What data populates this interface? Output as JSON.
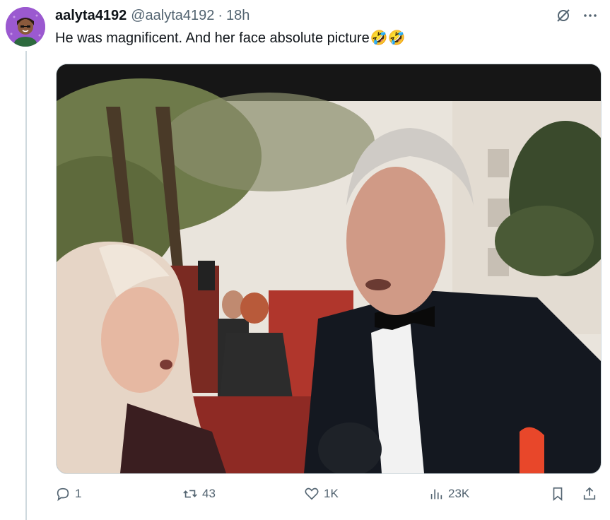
{
  "post": {
    "display_name": "aalyta4192",
    "handle": "@aalyta4192",
    "separator": "·",
    "time": "18h",
    "text": "He was magnificent. And her face absolute picture",
    "emojis": "🤣🤣"
  },
  "actions": {
    "replies": "1",
    "reposts": "43",
    "likes": "1K",
    "views": "23K"
  },
  "icons": [
    "avatar",
    "grok-icon",
    "more-icon",
    "reply-icon",
    "repost-icon",
    "like-icon",
    "views-icon",
    "bookmark-icon",
    "share-icon"
  ],
  "colors": {
    "text": "#0f1419",
    "secondary": "#536471",
    "border": "#cfd9de",
    "avatar_bg": "#9b59d0"
  }
}
